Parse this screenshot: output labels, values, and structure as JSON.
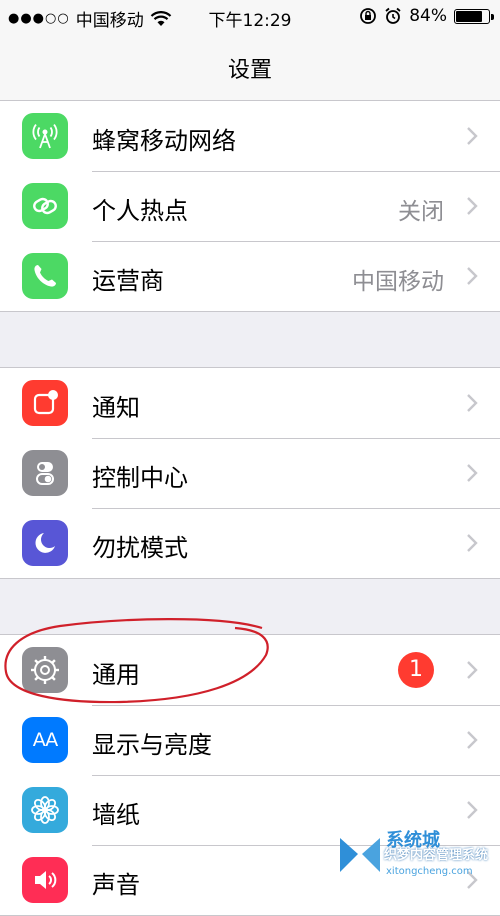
{
  "status_bar": {
    "signal": "●●●○○",
    "carrier": "中国移动",
    "time": "下午12:29",
    "battery_percent": "84%",
    "battery_level": 0.84
  },
  "nav": {
    "title": "设置"
  },
  "groups": [
    {
      "rows": [
        {
          "label": "蜂窝移动网络",
          "value": "",
          "icon": "cellular-icon",
          "color": "#4cd964"
        },
        {
          "label": "个人热点",
          "value": "关闭",
          "icon": "hotspot-icon",
          "color": "#4cd964"
        },
        {
          "label": "运营商",
          "value": "中国移动",
          "icon": "phone-icon",
          "color": "#4cd964"
        }
      ]
    },
    {
      "rows": [
        {
          "label": "通知",
          "value": "",
          "icon": "notifications-icon",
          "color": "#ff3b30"
        },
        {
          "label": "控制中心",
          "value": "",
          "icon": "control-center-icon",
          "color": "#8e8e93"
        },
        {
          "label": "勿扰模式",
          "value": "",
          "icon": "moon-icon",
          "color": "#5856d6"
        }
      ]
    },
    {
      "rows": [
        {
          "label": "通用",
          "value": "",
          "badge": "1",
          "icon": "gear-icon",
          "color": "#8e8e93"
        },
        {
          "label": "显示与亮度",
          "value": "",
          "icon": "display-brightness-icon",
          "color": "#007aff",
          "icon_text": "AA"
        },
        {
          "label": "墙纸",
          "value": "",
          "icon": "wallpaper-flower-icon",
          "color": "#34aadc"
        },
        {
          "label": "声音",
          "value": "",
          "icon": "speaker-icon",
          "color": "#ff2d55"
        }
      ]
    }
  ],
  "colors": {
    "chevron": "#c7c7cc",
    "annotation": "#d0202a",
    "badge": "#ff3b30"
  },
  "watermark": {
    "brand": "系统城",
    "line1": "织梦内容管理系统",
    "line2": "xitongcheng.com"
  }
}
